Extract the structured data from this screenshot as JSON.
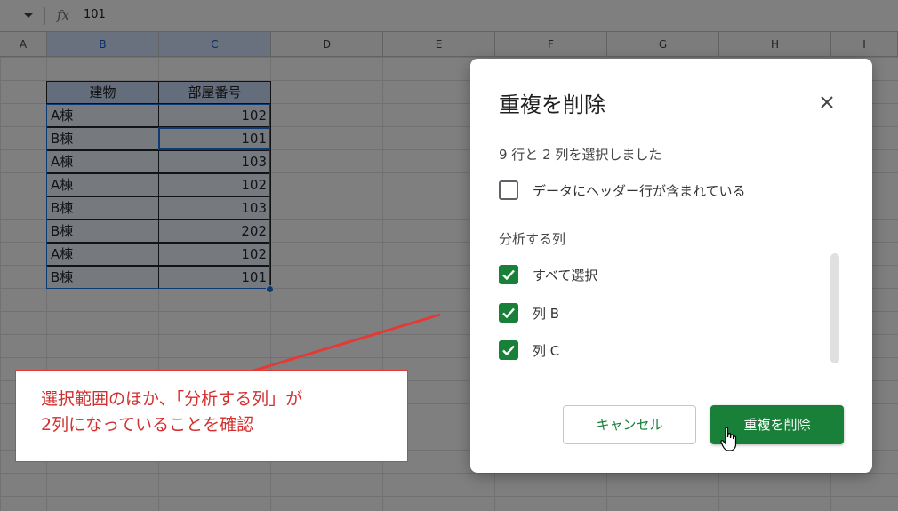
{
  "formula_bar": {
    "fx_label": "fx",
    "value": "101"
  },
  "columns": [
    "A",
    "B",
    "C",
    "D",
    "E",
    "F",
    "G",
    "H",
    "I"
  ],
  "table": {
    "headers": [
      "建物",
      "部屋番号"
    ],
    "rows": [
      [
        "A棟",
        "102"
      ],
      [
        "B棟",
        "101"
      ],
      [
        "A棟",
        "103"
      ],
      [
        "A棟",
        "102"
      ],
      [
        "B棟",
        "103"
      ],
      [
        "B棟",
        "202"
      ],
      [
        "A棟",
        "102"
      ],
      [
        "B棟",
        "101"
      ]
    ]
  },
  "dialog": {
    "title": "重複を削除",
    "selection_info": "9 行と 2 列を選択しました",
    "header_checkbox_label": "データにヘッダー行が含まれている",
    "header_checked": false,
    "section_label": "分析する列",
    "columns": [
      {
        "label": "すべて選択",
        "checked": true
      },
      {
        "label": "列 B",
        "checked": true
      },
      {
        "label": "列 C",
        "checked": true
      }
    ],
    "cancel_label": "キャンセル",
    "remove_label": "重複を削除"
  },
  "annotation": {
    "text": "選択範囲のほか、「分析する列」が\n2列になっていることを確認",
    "color": "#d32f2f"
  },
  "icons": {
    "close": "close-icon",
    "check": "check-icon",
    "cursor": "hand-pointer-icon",
    "dropdown": "dropdown-arrow-icon"
  }
}
